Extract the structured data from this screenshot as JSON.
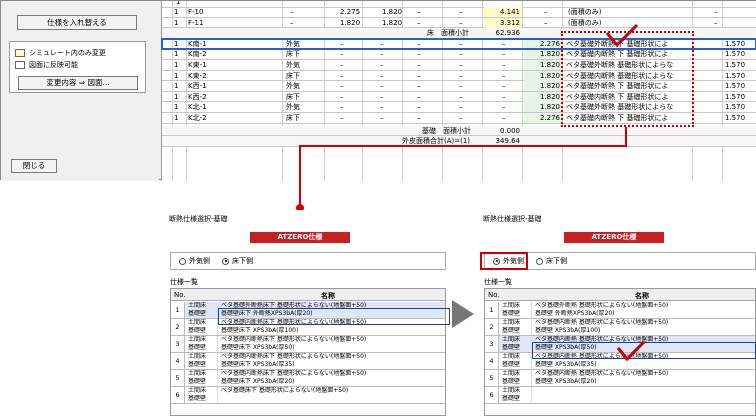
{
  "main_window": {
    "swap_button": "仕様を入れ替える",
    "legend": [
      {
        "label": "シミュレート内のみ変更",
        "color": "#fff7c6"
      },
      {
        "label": "図面に反映可能",
        "color": "#ffffff"
      }
    ],
    "apply_button": "変更内容 ⇒ 図面...",
    "close_button": "閉じる",
    "rows_top": [
      {
        "no": "1",
        "name": "F-10",
        "c1": "–",
        "c2": "2.275",
        "c3": "1.820",
        "c4": "–",
        "c5": "–",
        "c6": "4.141",
        "c7": "–",
        "c8": "(面積のみ)",
        "c9": "",
        "c10": "–"
      },
      {
        "no": "1",
        "name": "F-11",
        "c1": "–",
        "c2": "1.820",
        "c3": "1.820",
        "c4": "–",
        "c5": "–",
        "c6": "3.312",
        "c7": "–",
        "c8": "(面積のみ)",
        "c9": "",
        "c10": "–"
      }
    ],
    "subtotal_floor": {
      "label": "床　面積小計",
      "value": "62.936"
    },
    "rows_main": [
      {
        "no": "1",
        "name": "K南-1",
        "pos": "外気",
        "val": "2.276",
        "spec": "ベタ基礎外断熱 下 基礎形状によ",
        "num": "1.570"
      },
      {
        "no": "1",
        "name": "K南-2",
        "pos": "床下",
        "val": "1.820",
        "spec": "ベタ基礎内断熱 下 基礎形状によ",
        "num": "1.570"
      },
      {
        "no": "1",
        "name": "K東-1",
        "pos": "外気",
        "val": "1.820",
        "spec": "ベタ基礎外断熱 基礎形状によらな",
        "num": "1.570"
      },
      {
        "no": "1",
        "name": "K東-2",
        "pos": "床下",
        "val": "1.820",
        "spec": "ベタ基礎内断熱 基礎形状によらな",
        "num": "1.570"
      },
      {
        "no": "1",
        "name": "K西-1",
        "pos": "外気",
        "val": "1.820",
        "spec": "ベタ基礎外断熱 下 基礎形状によ",
        "num": "1.570"
      },
      {
        "no": "1",
        "name": "K西-2",
        "pos": "床下",
        "val": "1.820",
        "spec": "ベタ基礎内断熱 下 基礎形状によ",
        "num": "1.570"
      },
      {
        "no": "1",
        "name": "K北-1",
        "pos": "外気",
        "val": "1.820",
        "spec": "ベタ基礎外断熱 基礎形状によらな",
        "num": "1.570"
      },
      {
        "no": "1",
        "name": "K北-2",
        "pos": "床下",
        "val": "2.276",
        "spec": "ベタ基礎内断熱 下 基礎形状によ",
        "num": "1.570"
      }
    ],
    "dash": "–",
    "subtotal_base": {
      "label": "基礎　面積小計",
      "value": "0.000"
    },
    "total": {
      "label": "外皮面積合計(A)=(1)",
      "value": "349.64"
    }
  },
  "dialog_left": {
    "title": "断熱仕様選択-基礎",
    "banner": "ATZERO仕様",
    "radio_outer": "外気側",
    "radio_under": "床下側",
    "list_label": "仕様一覧",
    "col_no": "No.",
    "col_name": "名称",
    "groups": [
      {
        "no": "1",
        "k1": "土間床",
        "v1": "ベタ基礎外断熱床下 基礎形状によらない(地盤面+50)",
        "k2": "基礎壁",
        "v2": "基礎壁床下 外断熱XPS3bA(厚20)"
      },
      {
        "no": "2",
        "k1": "土間床",
        "v1": "ベタ基礎内断熱床下 基礎形状によらない(地盤面+50)",
        "k2": "基礎壁",
        "v2": "基礎壁床下 XPS3bA(厚100)"
      },
      {
        "no": "3",
        "k1": "土間床",
        "v1": "ベタ基礎内断熱床下 基礎形状によらない(地盤面+50)",
        "k2": "基礎壁",
        "v2": "基礎壁床下 XPS3bA(厚50)"
      },
      {
        "no": "4",
        "k1": "土間床",
        "v1": "ベタ基礎内断熱床下 基礎形状によらない(地盤面+50)",
        "k2": "基礎壁",
        "v2": "基礎壁床下 XPS3bA(厚35)"
      },
      {
        "no": "5",
        "k1": "土間床",
        "v1": "ベタ基礎内断熱床下 基礎形状によらない(地盤面+50)",
        "k2": "基礎壁",
        "v2": "基礎壁床下 XPS3bA(厚20)"
      },
      {
        "no": "6",
        "k1": "土間床",
        "v1": "ベタ基礎床下 基礎形状によらない(地盤面+50)",
        "k2": "基礎壁",
        "v2": ""
      }
    ]
  },
  "dialog_right": {
    "title": "断熱仕様選択-基礎",
    "banner": "ATZERO仕様",
    "radio_outer": "外気側",
    "radio_under": "床下側",
    "list_label": "仕様一覧",
    "col_no": "No.",
    "col_name": "名称",
    "groups": [
      {
        "no": "1",
        "k1": "土間床",
        "v1": "ベタ基礎外断熱 基礎形状によらない(地盤面+50)",
        "k2": "基礎壁",
        "v2": "基礎壁 外断熱XPS3bA(厚20)"
      },
      {
        "no": "2",
        "k1": "土間床",
        "v1": "ベタ基礎内断熱 基礎形状によらない(地盤面+50)",
        "k2": "基礎壁",
        "v2": "基礎壁 XPS3bA(厚100)"
      },
      {
        "no": "3",
        "k1": "土間床",
        "v1": "ベタ基礎内断熱 基礎形状によらない(地盤面+50)",
        "k2": "基礎壁",
        "v2": "基礎壁 XPS3bA(厚50)"
      },
      {
        "no": "4",
        "k1": "土間床",
        "v1": "ベタ基礎内断熱 基礎形状によらない(地盤面+50)",
        "k2": "基礎壁",
        "v2": "基礎壁 XPS3bA(厚35)"
      },
      {
        "no": "5",
        "k1": "土間床",
        "v1": "ベタ基礎内断熱 基礎形状によらない(地盤面+50)",
        "k2": "基礎壁",
        "v2": "基礎壁 XPS3bA(厚20)"
      },
      {
        "no": "6",
        "k1": "土間床",
        "v1": "",
        "k2": "基礎壁",
        "v2": ""
      }
    ]
  },
  "colors": {
    "highlight_red": "#cc0000",
    "selection_blue": "#1a3fa0",
    "banner_red": "#c82020"
  }
}
